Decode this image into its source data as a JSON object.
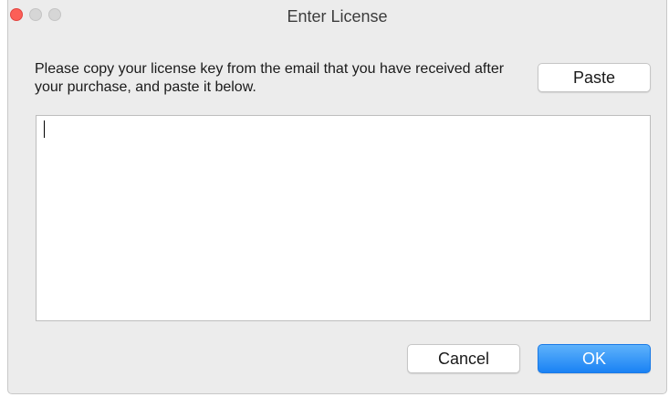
{
  "window": {
    "title": "Enter License"
  },
  "dialog": {
    "instructions": "Please copy your license key from the email that you have received after your purchase, and paste it below.",
    "license_value": "",
    "paste_label": "Paste",
    "cancel_label": "Cancel",
    "ok_label": "OK"
  },
  "colors": {
    "close_button": "#fc5f57",
    "ok_button": "#1a82f4",
    "window_background": "#ececec"
  }
}
